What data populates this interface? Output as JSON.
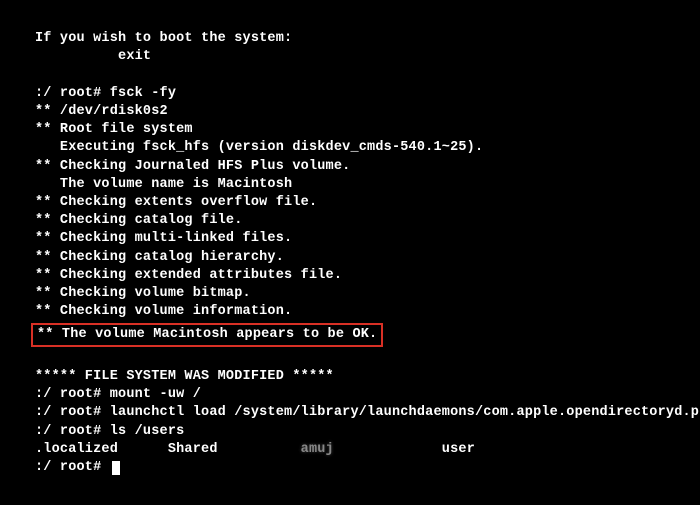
{
  "terminal": {
    "boot_hint_1": "If you wish to boot the system:",
    "boot_hint_2": "          exit",
    "cmd_fsck": ":/ root# fsck -fy",
    "dev_line": "** /dev/rdisk0s2",
    "root_fs": "** Root file system",
    "executing": "   Executing fsck_hfs (version diskdev_cmds-540.1~25).",
    "check_journal": "** Checking Journaled HFS Plus volume.",
    "volume_name": "   The volume name is Macintosh",
    "check_extents": "** Checking extents overflow file.",
    "check_catalog": "** Checking catalog file.",
    "check_multi": "** Checking multi-linked files.",
    "check_hierarchy": "** Checking catalog hierarchy.",
    "check_attrs": "** Checking extended attributes file.",
    "check_bitmap": "** Checking volume bitmap.",
    "check_info": "** Checking volume information.",
    "volume_ok": "** The volume Macintosh appears to be OK.",
    "fs_modified": "***** FILE SYSTEM WAS MODIFIED *****",
    "cmd_mount": ":/ root# mount -uw /",
    "cmd_launchctl": ":/ root# launchctl load /system/library/launchdaemons/com.apple.opendirectoryd.plist",
    "cmd_ls": ":/ root# ls /users",
    "ls_localized": ".localized",
    "ls_shared": "Shared",
    "ls_blurred": "amuj",
    "ls_user": "user",
    "prompt_final": ":/ root# "
  }
}
